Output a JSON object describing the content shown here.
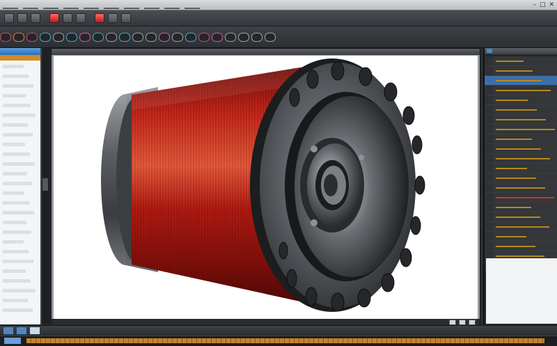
{
  "window": {
    "menu": [
      {
        "label": ""
      },
      {
        "label": ""
      },
      {
        "label": ""
      },
      {
        "label": ""
      },
      {
        "label": ""
      },
      {
        "label": ""
      },
      {
        "label": ""
      },
      {
        "label": ""
      },
      {
        "label": ""
      },
      {
        "label": ""
      }
    ],
    "controls": [
      {
        "icon": "minimize-icon"
      },
      {
        "icon": "maximize-icon"
      },
      {
        "icon": "close-icon"
      }
    ]
  },
  "toolbar_primary": {
    "tools": [
      {
        "icon": "new-icon"
      },
      {
        "icon": "open-icon"
      },
      {
        "icon": "save-icon"
      },
      {
        "icon": "undo-icon",
        "accent": "#c21818"
      },
      {
        "icon": "redo-icon"
      },
      {
        "icon": "cut-icon"
      },
      {
        "icon": "record-icon",
        "accent": "#c21818"
      },
      {
        "icon": "snap-icon"
      },
      {
        "icon": "render-icon"
      }
    ]
  },
  "toolbar_secondary": {
    "tools": [
      "select-icon",
      "move-icon",
      "rotate-icon",
      "scale-icon",
      "extrude-icon",
      "bevel-icon",
      "loop-cut-icon",
      "knife-icon",
      "mirror-icon",
      "array-icon",
      "boolean-icon",
      "smooth-icon",
      "subdivide-icon",
      "inset-icon",
      "bridge-icon",
      "spin-icon",
      "screw-icon",
      "solidify-icon",
      "bend-icon",
      "twist-icon",
      "measure-icon"
    ]
  },
  "viewport": {
    "object": "motor-stator-coil",
    "colors": {
      "copper": "#b11a12",
      "steel": "#55585d",
      "background": "#ffffff"
    }
  },
  "properties_panel": {
    "rows": 22,
    "selected_index": 2,
    "accent_index": 14
  },
  "status": {
    "text": ""
  },
  "colors": {
    "chrome_dark": "#2b2d31",
    "accent_blue": "#3b8ed8",
    "accent_orange": "#c9822a",
    "accent_red": "#c21818"
  }
}
